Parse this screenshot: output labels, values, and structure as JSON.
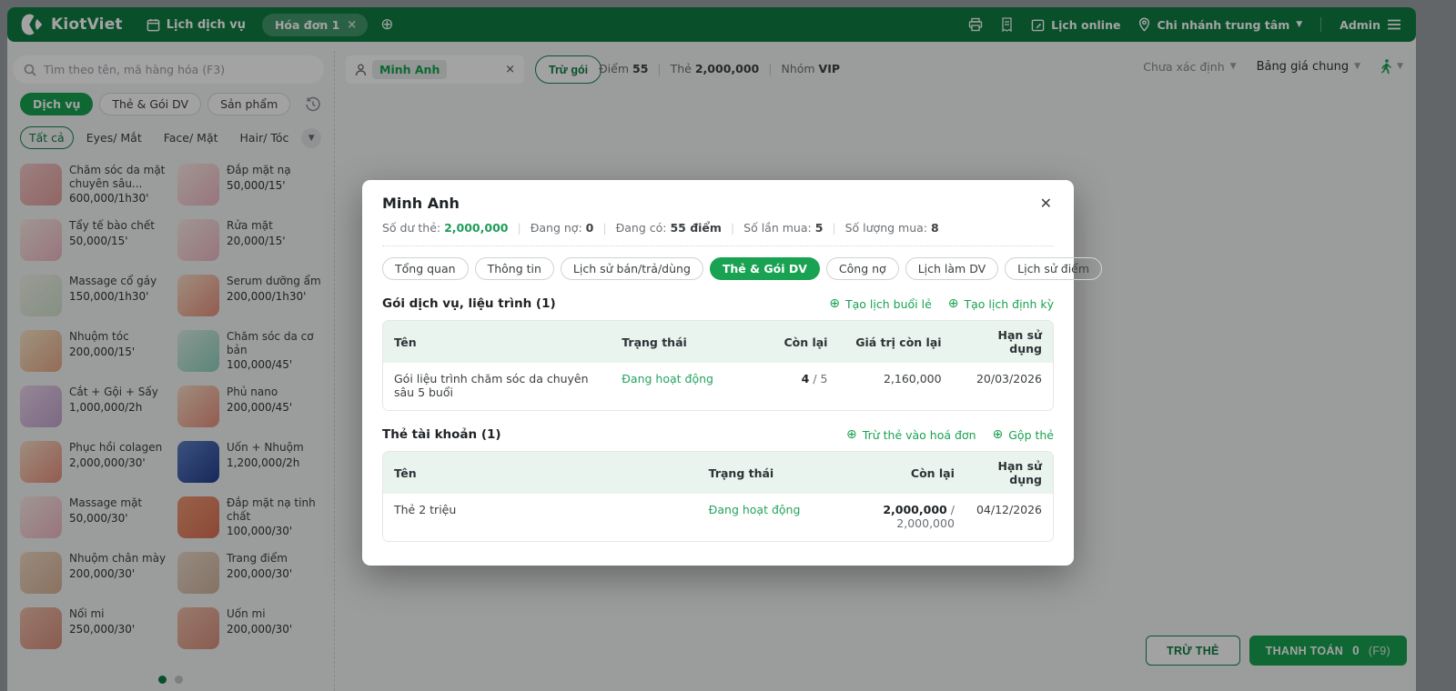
{
  "colors": {
    "brand_green": "#0e7c42",
    "accent_green": "#18a251",
    "status_green": "#24a35f",
    "table_header_bg": "#e9f4ee"
  },
  "topbar": {
    "brand": "KiotViet",
    "nav_schedule": "Lịch dịch vụ",
    "invoice_tab": "Hóa đơn 1",
    "lich_online": "Lịch online",
    "branch": "Chi nhánh trung tâm",
    "user": "Admin"
  },
  "toolbar": {
    "search_placeholder": "Tìm theo tên, mã hàng hóa (F3)",
    "customer_name": "Minh Anh",
    "deduct_package": "Trừ gói",
    "stats": [
      {
        "label": "Điểm",
        "value": "55",
        "green": true
      },
      {
        "label": "Thẻ",
        "value": "2,000,000",
        "green": true
      },
      {
        "label": "Nhóm",
        "value": "VIP",
        "green": false
      }
    ],
    "status_select": "Chưa xác định",
    "pricebook_select": "Bảng giá chung"
  },
  "panel": {
    "chips": [
      {
        "id": "dich-vu",
        "label": "Dịch vụ",
        "active": true
      },
      {
        "id": "the-goi-dv",
        "label": "Thẻ & Gói DV",
        "active": false
      },
      {
        "id": "san-pham",
        "label": "Sản phẩm",
        "active": false
      }
    ],
    "categories": [
      {
        "id": "tat-ca",
        "label": "Tất cả",
        "active": true
      },
      {
        "id": "eyes",
        "label": "Eyes/ Mắt",
        "active": false
      },
      {
        "id": "face",
        "label": "Face/ Mặt",
        "active": false
      },
      {
        "id": "hair",
        "label": "Hair/ Tóc",
        "active": false
      }
    ],
    "services": [
      {
        "name": "Chăm sóc da mặt chuyên sâu...",
        "price": "600,000/1h30'",
        "c1": "#f2c9c9",
        "c2": "#e3a09e"
      },
      {
        "name": "Đắp mặt nạ",
        "price": "50,000/15'",
        "c1": "#fbeae6",
        "c2": "#edb8c4"
      },
      {
        "name": "Tẩy tế bào chết",
        "price": "50,000/15'",
        "c1": "#fbeae6",
        "c2": "#edb8c4"
      },
      {
        "name": "Rửa mặt",
        "price": "20,000/15'",
        "c1": "#fbeae6",
        "c2": "#edb8c4"
      },
      {
        "name": "Massage cổ gáy",
        "price": "150,000/1h30'",
        "c1": "#f3f1ea",
        "c2": "#cfe3cd"
      },
      {
        "name": "Serum dưỡng ẩm",
        "price": "200,000/1h30'",
        "c1": "#f8ddc7",
        "c2": "#e8907c"
      },
      {
        "name": "Nhuộm tóc",
        "price": "200,000/15'",
        "c1": "#f8e6c8",
        "c2": "#e8a987"
      },
      {
        "name": "Chăm sóc da cơ bản",
        "price": "100,000/45'",
        "c1": "#d9efe6",
        "c2": "#8fd0bd"
      },
      {
        "name": "Cắt + Gội + Sấy",
        "price": "1,000,000/2h",
        "c1": "#e8d4ec",
        "c2": "#c3a3cd"
      },
      {
        "name": "Phủ nano",
        "price": "200,000/45'",
        "c1": "#f8ddc7",
        "c2": "#e8907c"
      },
      {
        "name": "Phục hồi colagen",
        "price": "2,000,000/30'",
        "c1": "#f8ddc7",
        "c2": "#e8907c"
      },
      {
        "name": "Uốn + Nhuộm",
        "price": "1,200,000/2h",
        "c1": "#5d7fc4",
        "c2": "#24408f"
      },
      {
        "name": "Massage mặt",
        "price": "50,000/30'",
        "c1": "#fbeae6",
        "c2": "#edb8c4"
      },
      {
        "name": "Đắp mặt nạ tinh chất",
        "price": "100,000/30'",
        "c1": "#ec9a74",
        "c2": "#dd6f55"
      },
      {
        "name": "Nhuộm chân mày",
        "price": "200,000/30'",
        "c1": "#efd9c4",
        "c2": "#d9b396"
      },
      {
        "name": "Trang điểm",
        "price": "200,000/30'",
        "c1": "#ead9ca",
        "c2": "#d0b49d"
      },
      {
        "name": "Nối mi",
        "price": "250,000/30'",
        "c1": "#edbfab",
        "c2": "#d98f7e"
      },
      {
        "name": "Uốn mi",
        "price": "200,000/30'",
        "c1": "#edbfab",
        "c2": "#d98f7e"
      }
    ]
  },
  "footer": {
    "deduct_card": "TRỪ THẺ",
    "checkout": "THANH TOÁN",
    "checkout_amount": "0",
    "checkout_key": "(F9)"
  },
  "modal": {
    "title": "Minh Anh",
    "stats": [
      {
        "label": "Số dư thẻ:",
        "value": "2,000,000",
        "green": true
      },
      {
        "label": "Đang nợ:",
        "value": "0",
        "green": false
      },
      {
        "label": "Đang có:",
        "value": "55 điểm",
        "green": false
      },
      {
        "label": "Số lần mua:",
        "value": "5",
        "green": false
      },
      {
        "label": "Số lượng mua:",
        "value": "8",
        "green": false
      }
    ],
    "tabs": [
      {
        "id": "tong-quan",
        "label": "Tổng quan",
        "active": false
      },
      {
        "id": "thong-tin",
        "label": "Thông tin",
        "active": false
      },
      {
        "id": "lich-su-ban",
        "label": "Lịch sử bán/trả/dùng",
        "active": false
      },
      {
        "id": "the-goi-dv",
        "label": "Thẻ & Gói DV",
        "active": true
      },
      {
        "id": "cong-no",
        "label": "Công nợ",
        "active": false
      },
      {
        "id": "lich-lam-dv",
        "label": "Lịch làm DV",
        "active": false
      },
      {
        "id": "lich-su-diem",
        "label": "Lịch sử điểm",
        "active": false
      }
    ],
    "section1": {
      "title": "Gói dịch vụ, liệu trình (1)",
      "actions": [
        {
          "id": "tao-lich-buoi-le",
          "label": "Tạo lịch buổi lẻ"
        },
        {
          "id": "tao-lich-dinh-ky",
          "label": "Tạo lịch định kỳ"
        }
      ],
      "headers": [
        "Tên",
        "Trạng thái",
        "Còn lại",
        "Giá trị còn lại",
        "Hạn sử dụng"
      ],
      "row": {
        "name": "Gói liệu trình chăm sóc da chuyên sâu 5 buổi",
        "status": "Đang hoạt động",
        "remaining": "4",
        "remaining_total": " / 5",
        "value": "2,160,000",
        "expiry": "20/03/2026"
      }
    },
    "section2": {
      "title": "Thẻ tài khoản (1)",
      "actions": [
        {
          "id": "tru-the-vao-hoa-don",
          "label": "Trừ thẻ vào hoá đơn"
        },
        {
          "id": "gop-the",
          "label": "Gộp thẻ"
        }
      ],
      "headers": [
        "Tên",
        "Trạng thái",
        "Còn lại",
        "Hạn sử dụng"
      ],
      "row": {
        "name": "Thẻ 2 triệu",
        "status": "Đang hoạt động",
        "remaining": "2,000,000",
        "remaining_total": " / 2,000,000",
        "expiry": "04/12/2026"
      }
    }
  }
}
